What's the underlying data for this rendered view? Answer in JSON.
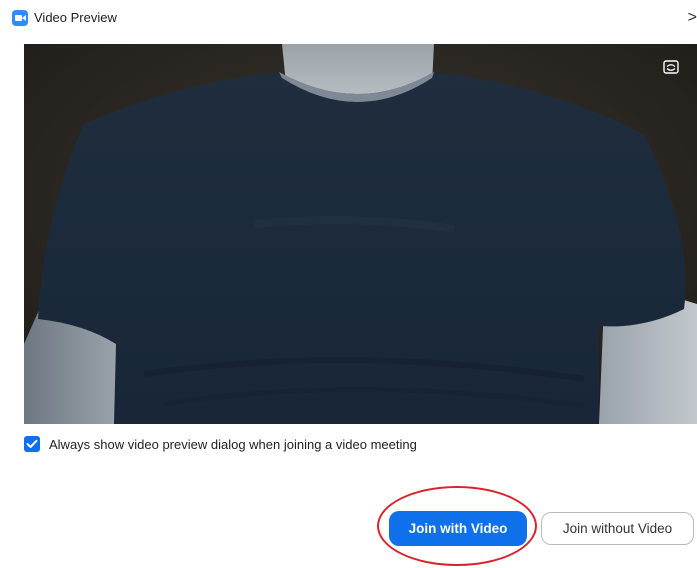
{
  "window": {
    "title": "Video Preview",
    "close_glyph": ">"
  },
  "video": {
    "switch_camera_icon": "switch-camera-icon"
  },
  "options": {
    "always_show_preview_label": "Always show video preview dialog when joining a video meeting",
    "always_show_preview_checked": true
  },
  "actions": {
    "join_with_video_label": "Join with Video",
    "join_without_video_label": "Join without Video"
  },
  "colors": {
    "accent": "#0e71eb",
    "app_icon": "#2d8cff",
    "annotation": "#d9232a"
  }
}
